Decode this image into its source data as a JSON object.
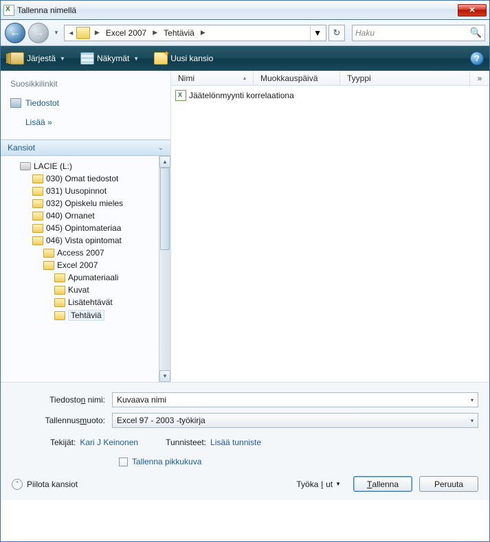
{
  "title": "Tallenna nimellä",
  "breadcrumb": {
    "segments": [
      "Excel 2007",
      "Tehtäviä"
    ]
  },
  "search": {
    "placeholder": "Haku"
  },
  "toolbar": {
    "organize": "Järjestä",
    "views": "Näkymät",
    "newfolder": "Uusi kansio"
  },
  "favorites": {
    "header": "Suosikkilinkit",
    "documents": "Tiedostot",
    "more": "Lisää »"
  },
  "folders_header": "Kansiot",
  "tree": {
    "drive": "LACIE (L:)",
    "n030": "030) Omat tiedostot",
    "n031": "031) Uusopinnot",
    "n032": "032) Opiskelu mieles",
    "n040": "040) Ornanet",
    "n045": "045) Opintomateriaa",
    "n046": "046) Vista opintomat",
    "access": "Access 2007",
    "excel": "Excel 2007",
    "apum": "Apumateriaali",
    "kuvat": "Kuvat",
    "lisat": "Lisätehtävät",
    "teht": "Tehtäviä"
  },
  "columns": {
    "name": "Nimi",
    "modified": "Muokkauspäivä",
    "type": "Tyyppi",
    "more": "»"
  },
  "files": {
    "f0": "Jäätelönmyynti korrelaationa"
  },
  "form": {
    "filename_label_pre": "Tiedosto",
    "filename_label_ul": "n",
    "filename_label_post": " nimi:",
    "filename_value": "Kuvaava nimi",
    "format_label_pre": "Tallennus",
    "format_label_ul": "m",
    "format_label_post": "uoto:",
    "format_value": "Excel 97 - 2003 -työkirja",
    "authors_label": "Tekijät:",
    "authors_value": "Kari J Keinonen",
    "tags_label": "Tunnisteet:",
    "tags_value": "Lisää tunniste",
    "thumbnail": "Tallenna pikkukuva"
  },
  "footer": {
    "hide": "Piilota kansiot",
    "tools_pre": "Työka",
    "tools_ul": "l",
    "tools_post": "ut",
    "save_ul": "T",
    "save_post": "allenna",
    "cancel": "Peruuta"
  }
}
